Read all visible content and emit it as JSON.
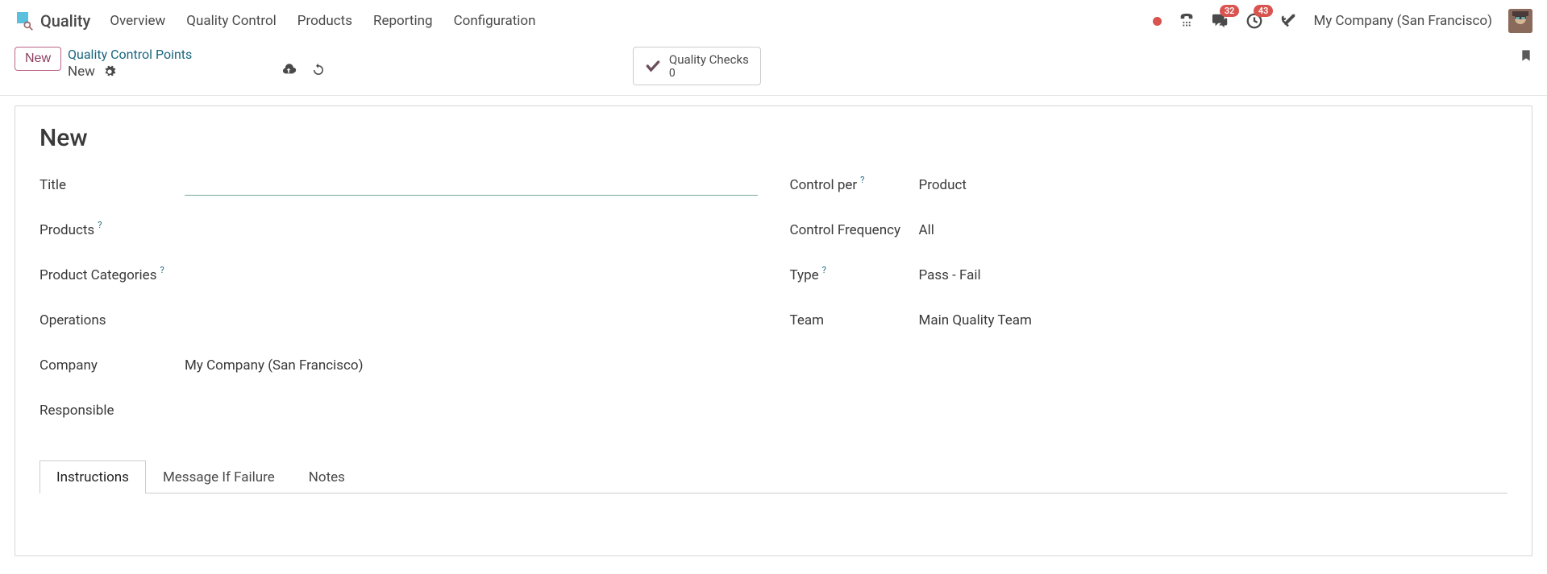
{
  "app": {
    "name": "Quality"
  },
  "nav": {
    "items": [
      "Overview",
      "Quality Control",
      "Products",
      "Reporting",
      "Configuration"
    ]
  },
  "topbar": {
    "messages_badge": "32",
    "activities_badge": "43",
    "company": "My Company (San Francisco)"
  },
  "control": {
    "new_button": "New",
    "breadcrumb_link": "Quality Control Points",
    "breadcrumb_current": "New",
    "quality_checks_label": "Quality Checks",
    "quality_checks_count": "0"
  },
  "form": {
    "title_heading": "New",
    "left": {
      "title_label": "Title",
      "title_value": "",
      "products_label": "Products",
      "product_categories_label": "Product Categories",
      "operations_label": "Operations",
      "company_label": "Company",
      "company_value": "My Company (San Francisco)",
      "responsible_label": "Responsible"
    },
    "right": {
      "control_per_label": "Control per",
      "control_per_value": "Product",
      "control_frequency_label": "Control Frequency",
      "control_frequency_value": "All",
      "type_label": "Type",
      "type_value": "Pass - Fail",
      "team_label": "Team",
      "team_value": "Main Quality Team"
    },
    "tabs": {
      "instructions": "Instructions",
      "message_if_failure": "Message If Failure",
      "notes": "Notes"
    }
  }
}
